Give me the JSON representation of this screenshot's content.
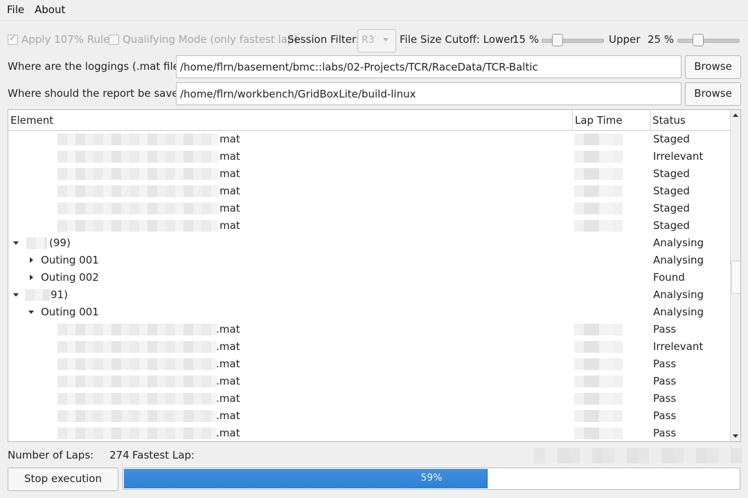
{
  "menu": {
    "file": "File",
    "about": "About"
  },
  "options": {
    "apply_rule_label": "Apply 107% Rule",
    "apply_rule_checked": true,
    "qualifying_label": "Qualifying Mode (only fastest lap)",
    "qualifying_checked": false,
    "session_filter_label": "Session Filter:",
    "session_filter_value": "R3",
    "file_size_label": "File Size Cutoff: Lower",
    "lower_value": "15 %",
    "lower_fraction": 0.2,
    "upper_label": "Upper",
    "upper_value": "25 %",
    "upper_fraction": 0.3
  },
  "paths": {
    "loggings_label": "Where are the loggings (.mat files)?",
    "loggings_value": "/home/flrn/basement/bmc::labs/02-Projects/TCR/RaceData/TCR-Baltic",
    "loggings_browse": "Browse",
    "report_label": "Where should the report be saved?",
    "report_value": "/home/flrn/workbench/GridBoxLite/build-linux",
    "report_browse": "Browse"
  },
  "tree": {
    "headers": [
      "Element",
      "Lap Time",
      "Status"
    ],
    "rows": [
      {
        "type": "file",
        "suffix": "mat",
        "status": "Staged"
      },
      {
        "type": "file",
        "suffix": "mat",
        "status": "Irrelevant"
      },
      {
        "type": "file",
        "suffix": "mat",
        "status": "Staged"
      },
      {
        "type": "file",
        "suffix": "mat",
        "status": "Staged"
      },
      {
        "type": "file",
        "suffix": "mat",
        "status": "Staged"
      },
      {
        "type": "file",
        "suffix": "mat",
        "status": "Staged"
      },
      {
        "type": "group",
        "label": "(99)",
        "expanded": true,
        "status": "Analysing"
      },
      {
        "type": "outing",
        "label": "Outing 001",
        "expanded": false,
        "status": "Analysing"
      },
      {
        "type": "outing",
        "label": "Outing 002",
        "expanded": false,
        "status": "Found"
      },
      {
        "type": "group",
        "label": "91)",
        "expanded": true,
        "status": "Analysing"
      },
      {
        "type": "outing",
        "label": "Outing 001",
        "expanded": true,
        "status": "Analysing"
      },
      {
        "type": "file",
        "suffix": ".mat",
        "status": "Pass"
      },
      {
        "type": "file",
        "suffix": ".mat",
        "status": "Irrelevant"
      },
      {
        "type": "file",
        "suffix": ".mat",
        "status": "Pass"
      },
      {
        "type": "file",
        "suffix": ".mat",
        "status": "Pass"
      },
      {
        "type": "file",
        "suffix": ".mat",
        "status": "Pass"
      },
      {
        "type": "file",
        "suffix": ".mat",
        "status": "Pass"
      },
      {
        "type": "file",
        "suffix": ".mat",
        "status": "Pass"
      }
    ]
  },
  "footer": {
    "laps_label": "Number of Laps:",
    "laps_value": "274",
    "fastest_label": "Fastest Lap:",
    "stop_button": "Stop execution",
    "progress_percent": 59,
    "progress_text": "59%"
  },
  "colors": {
    "accent": "#3a8ad9",
    "background": "#efefef"
  }
}
